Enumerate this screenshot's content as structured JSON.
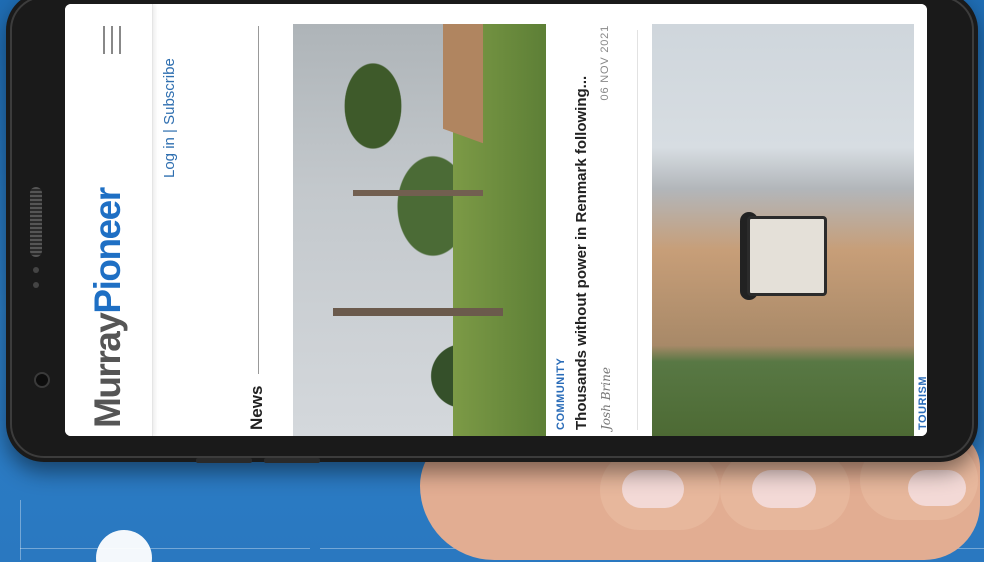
{
  "app": {
    "brand_part1": "Murray",
    "brand_part2": "Pioneer",
    "auth_text": "Log in | Subscribe"
  },
  "section": {
    "title": "News"
  },
  "articles": [
    {
      "category": "COMMUNITY",
      "headline": "Thousands without power in Renmark following...",
      "author": "Josh Brine",
      "date": "06 NOV 2021"
    },
    {
      "category": "TOURISM"
    }
  ],
  "icons": {
    "menu": "hamburger-menu-icon"
  },
  "colors": {
    "brand_blue": "#1e6fc4",
    "brand_grey": "#555555",
    "category_blue": "#2a6cb8",
    "background_blue": "#2c7fc8"
  }
}
